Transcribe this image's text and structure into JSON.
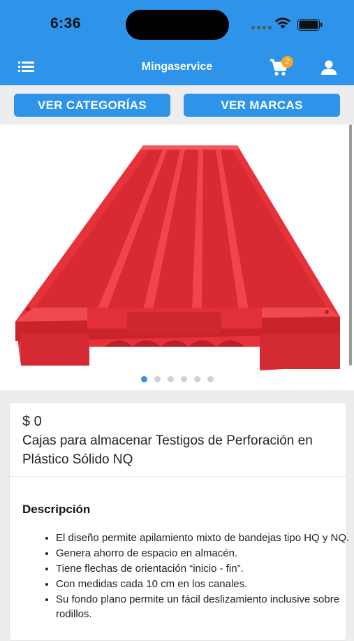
{
  "status": {
    "time": "6:36"
  },
  "header": {
    "title": "Mingaservice",
    "cart_count": "2"
  },
  "nav_buttons": {
    "categories_label": "VER CATEGORÍAS",
    "brands_label": "VER MARCAS"
  },
  "gallery": {
    "image_icon": "red-core-tray",
    "slides_total": 6,
    "active_slide": 1
  },
  "product": {
    "price": "$ 0",
    "name": "Cajas para almacenar Testigos de Perforación en Plástico Sólido NQ",
    "description_title": "Descripción",
    "description_items": [
      "El diseño permite apilamiento mixto de bandejas tipo HQ y NQ.",
      "Genera ahorro de espacio en almacén.",
      "Tiene flechas de orientación “inicio - fin”.",
      "Con medidas cada 10 cm en los canales.",
      "Su fondo plano permite un fácil deslizamiento inclusive sobre rodillos."
    ]
  },
  "colors": {
    "brand": "#2e94ea",
    "badge": "#f5a524",
    "product": "#e8323a"
  }
}
